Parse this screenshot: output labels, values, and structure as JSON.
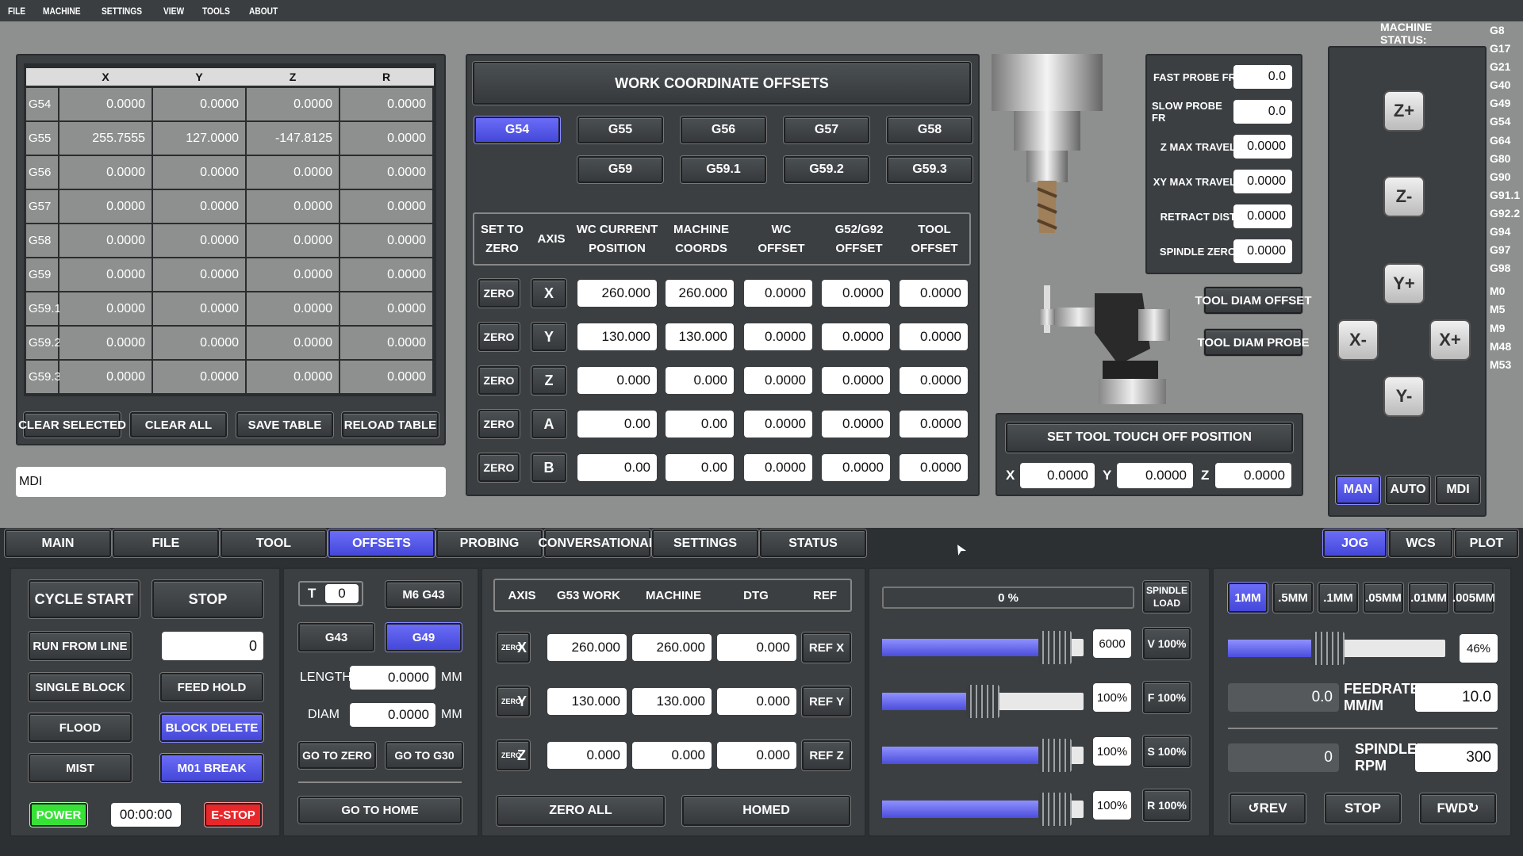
{
  "menu": [
    "FILE",
    "MACHINE",
    "SETTINGS",
    "VIEW",
    "TOOLS",
    "ABOUT"
  ],
  "machine_status": {
    "label": "MACHINE STATUS:",
    "codes": [
      "G8",
      "G17",
      "G21",
      "G40",
      "G49",
      "G54",
      "G64",
      "G80",
      "G90",
      "G91.1",
      "G92.2",
      "G94",
      "G97",
      "G98",
      "M0",
      "M5",
      "M9",
      "M48",
      "M53"
    ]
  },
  "offset_table": {
    "headers": [
      "X",
      "Y",
      "Z",
      "R"
    ],
    "rows": [
      {
        "name": "G54",
        "x": "0.0000",
        "y": "0.0000",
        "z": "0.0000",
        "r": "0.0000"
      },
      {
        "name": "G55",
        "x": "255.7555",
        "y": "127.0000",
        "z": "-147.8125",
        "r": "0.0000"
      },
      {
        "name": "G56",
        "x": "0.0000",
        "y": "0.0000",
        "z": "0.0000",
        "r": "0.0000"
      },
      {
        "name": "G57",
        "x": "0.0000",
        "y": "0.0000",
        "z": "0.0000",
        "r": "0.0000"
      },
      {
        "name": "G58",
        "x": "0.0000",
        "y": "0.0000",
        "z": "0.0000",
        "r": "0.0000"
      },
      {
        "name": "G59",
        "x": "0.0000",
        "y": "0.0000",
        "z": "0.0000",
        "r": "0.0000"
      },
      {
        "name": "G59.1",
        "x": "0.0000",
        "y": "0.0000",
        "z": "0.0000",
        "r": "0.0000"
      },
      {
        "name": "G59.2",
        "x": "0.0000",
        "y": "0.0000",
        "z": "0.0000",
        "r": "0.0000"
      },
      {
        "name": "G59.3",
        "x": "0.0000",
        "y": "0.0000",
        "z": "0.0000",
        "r": "0.0000"
      }
    ],
    "buttons": {
      "clear_selected": "CLEAR SELECTED",
      "clear_all": "CLEAR ALL",
      "save": "SAVE TABLE",
      "reload": "RELOAD TABLE"
    }
  },
  "mdi": {
    "value": "MDI"
  },
  "wco": {
    "title": "WORK COORDINATE OFFSETS",
    "buttons_row1": [
      "G54",
      "G55",
      "G56",
      "G57",
      "G58"
    ],
    "buttons_row2": [
      "G59",
      "G59.1",
      "G59.2",
      "G59.3"
    ],
    "headers": [
      "SET TO\nZERO",
      "AXIS",
      "WC CURRENT\nPOSITION",
      "MACHINE\nCOORDS",
      "WC\nOFFSET",
      "G52/G92\nOFFSET",
      "TOOL\nOFFSET"
    ],
    "zero_label": "ZERO",
    "rows": [
      {
        "axis": "X",
        "wc": "260.000",
        "mach": "260.000",
        "wco": "0.0000",
        "g52": "0.0000",
        "tool": "0.0000"
      },
      {
        "axis": "Y",
        "wc": "130.000",
        "mach": "130.000",
        "wco": "0.0000",
        "g52": "0.0000",
        "tool": "0.0000"
      },
      {
        "axis": "Z",
        "wc": "0.000",
        "mach": "0.000",
        "wco": "0.0000",
        "g52": "0.0000",
        "tool": "0.0000"
      },
      {
        "axis": "A",
        "wc": "0.00",
        "mach": "0.00",
        "wco": "0.0000",
        "g52": "0.0000",
        "tool": "0.0000"
      },
      {
        "axis": "B",
        "wc": "0.00",
        "mach": "0.00",
        "wco": "0.0000",
        "g52": "0.0000",
        "tool": "0.0000"
      }
    ]
  },
  "probe": {
    "fields": [
      {
        "label": "FAST PROBE FR",
        "value": "0.0"
      },
      {
        "label": "SLOW PROBE FR",
        "value": "0.0"
      },
      {
        "label": "Z MAX TRAVEL",
        "value": "0.0000"
      },
      {
        "label": "XY MAX TRAVEL",
        "value": "0.0000"
      },
      {
        "label": "RETRACT DIST",
        "value": "0.0000"
      },
      {
        "label": "SPINDLE ZERO",
        "value": "0.0000"
      }
    ],
    "tool_diam_offset": "TOOL DIAM OFFSET",
    "tool_diam_probe": "TOOL DIAM PROBE"
  },
  "touchoff": {
    "title": "SET TOOL TOUCH OFF POSITION",
    "x_label": "X",
    "x": "0.0000",
    "y_label": "Y",
    "y": "0.0000",
    "z_label": "Z",
    "z": "0.0000"
  },
  "jogpad": {
    "zplus": "Z+",
    "zminus": "Z-",
    "yplus": "Y+",
    "yminus": "Y-",
    "xminus": "X-",
    "xplus": "X+",
    "modes": [
      "MAN",
      "AUTO",
      "MDI"
    ]
  },
  "tabs": [
    "MAIN",
    "FILE",
    "TOOL",
    "OFFSETS",
    "PROBING",
    "CONVERSATIONAL",
    "SETTINGS",
    "STATUS"
  ],
  "right_tabs": [
    "JOG",
    "WCS",
    "PLOT"
  ],
  "control": {
    "cycle_start": "CYCLE START",
    "stop": "STOP",
    "run_from_line": "RUN FROM LINE",
    "line": "0",
    "single_block": "SINGLE BLOCK",
    "feed_hold": "FEED HOLD",
    "flood": "FLOOD",
    "block_delete": "BLOCK DELETE",
    "mist": "MIST",
    "m01": "M01 BREAK",
    "power": "POWER",
    "timer": "00:00:00",
    "estop": "E-STOP"
  },
  "tool": {
    "t_label": "T",
    "t_value": "0",
    "m6": "M6 G43",
    "g43": "G43",
    "g49": "G49",
    "length_label": "LENGTH",
    "length": "0.0000",
    "diam_label": "DIAM",
    "diam": "0.0000",
    "unit": "MM",
    "goto_zero": "GO TO ZERO",
    "goto_g30": "GO TO G30",
    "goto_home": "GO TO HOME"
  },
  "dro": {
    "headers": [
      "AXIS",
      "G53 WORK",
      "MACHINE",
      "DTG",
      "REF"
    ],
    "zero": "ZERO",
    "rows": [
      {
        "axis": "X",
        "work": "260.000",
        "mach": "260.000",
        "dtg": "0.000",
        "ref": "REF X"
      },
      {
        "axis": "Y",
        "work": "130.000",
        "mach": "130.000",
        "dtg": "0.000",
        "ref": "REF Y"
      },
      {
        "axis": "Z",
        "work": "0.000",
        "mach": "0.000",
        "dtg": "0.000",
        "ref": "REF Z"
      }
    ],
    "zero_all": "ZERO ALL",
    "homed": "HOMED"
  },
  "overrides": {
    "load": "0 %",
    "spindle_load": "SPINDLE\nLOAD",
    "sliders": [
      {
        "value": "6000",
        "btn": "V 100%",
        "fill": 0.86
      },
      {
        "value": "100%",
        "btn": "F 100%",
        "fill": 0.5
      },
      {
        "value": "100%",
        "btn": "S 100%",
        "fill": 0.86
      },
      {
        "value": "100%",
        "btn": "R 100%",
        "fill": 0.86
      }
    ]
  },
  "jog": {
    "steps": [
      "1MM",
      ".5MM",
      ".1MM",
      ".05MM",
      ".01MM",
      ".005MM"
    ],
    "jog_pct": "46%",
    "jog_fill": 0.46,
    "feed_actual": "0.0",
    "feed_label": "FEEDRATE MM/M",
    "feed_set": "10.0",
    "rpm_actual": "0",
    "rpm_label": "SPINDLE RPM",
    "rpm_set": "300",
    "rev": "REV",
    "stop": "STOP",
    "fwd": "FWD"
  }
}
